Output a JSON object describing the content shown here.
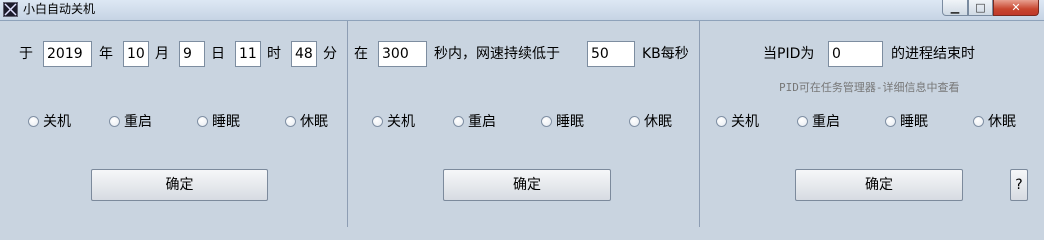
{
  "window": {
    "title": "小白自动关机",
    "minimize_label": "▁",
    "maximize_label": "□",
    "close_label": "✕",
    "app_icon": "x-mark-icon"
  },
  "schedule_panel": {
    "prefix": "于",
    "year_value": "2019",
    "year_unit": "年",
    "month_value": "10",
    "month_unit": "月",
    "day_value": "9",
    "day_unit": "日",
    "hour_value": "11",
    "hour_unit": "时",
    "minute_value": "48",
    "minute_unit": "分",
    "actions": [
      "关机",
      "重启",
      "睡眠",
      "休眠"
    ],
    "confirm_label": "确定"
  },
  "network_panel": {
    "prefix": "在",
    "seconds_value": "300",
    "middle_text": "秒内，网速持续低于",
    "speed_value": "50",
    "unit": "KB每秒",
    "actions": [
      "关机",
      "重启",
      "睡眠",
      "休眠"
    ],
    "confirm_label": "确定"
  },
  "process_panel": {
    "prefix": "当PID为",
    "pid_value": "0",
    "suffix": "的进程结束时",
    "hint": "PID可在任务管理器-详细信息中查看",
    "actions": [
      "关机",
      "重启",
      "睡眠",
      "休眠"
    ],
    "confirm_label": "确定",
    "help_label": "?"
  },
  "colors": {
    "background": "#c9d4e0",
    "divider": "#8d9db3",
    "close_button": "#c0392b"
  }
}
